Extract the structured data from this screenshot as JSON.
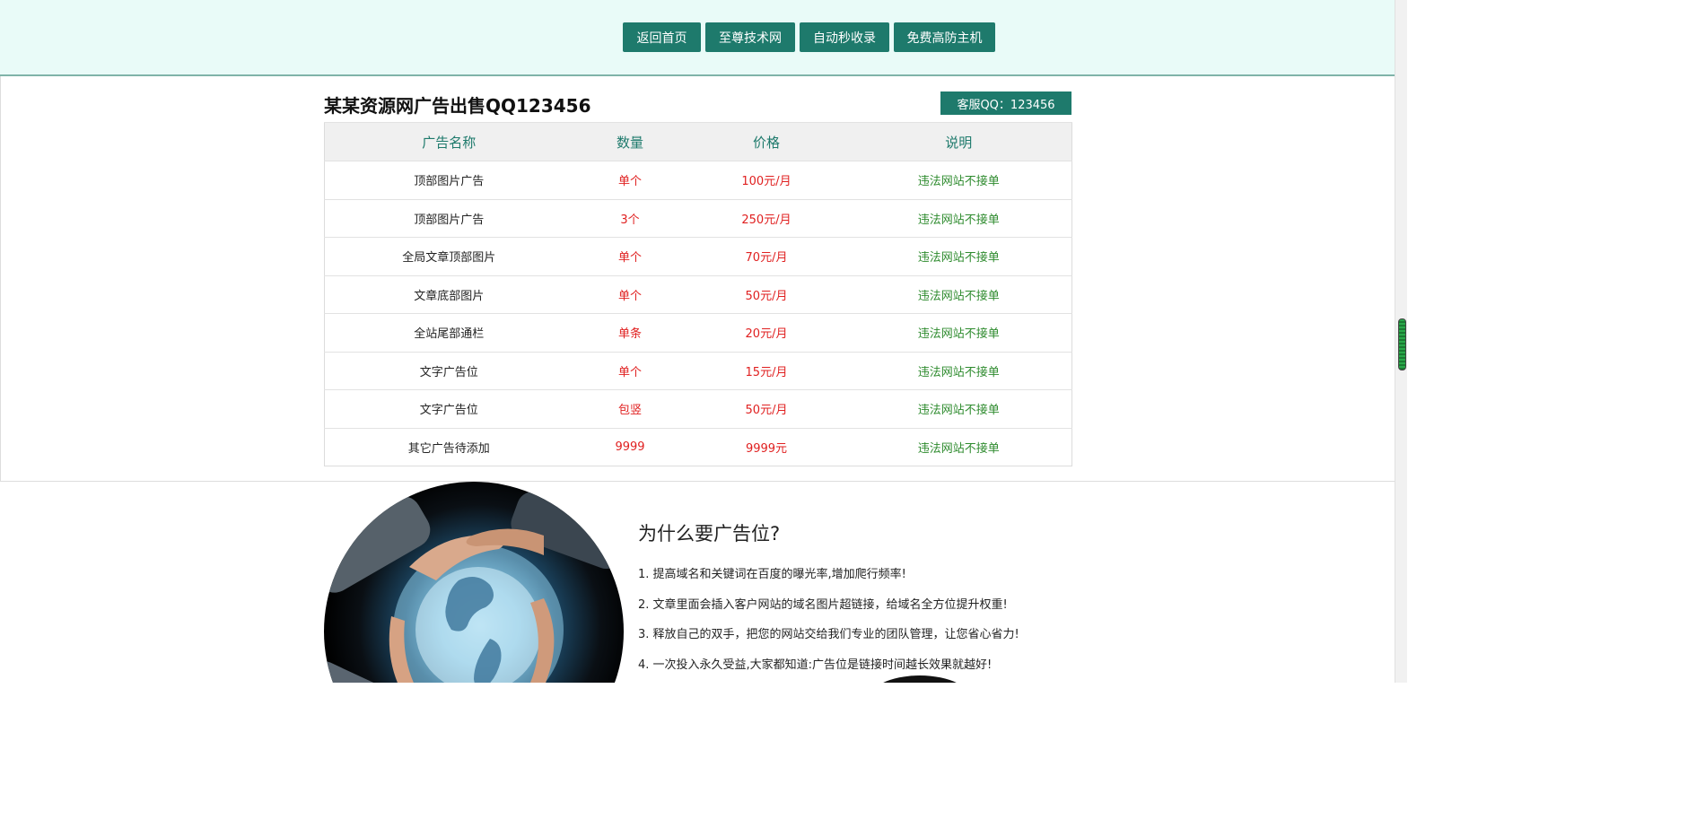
{
  "nav": {
    "items": [
      {
        "label": "返回首页"
      },
      {
        "label": "至尊技术网"
      },
      {
        "label": "自动秒收录"
      },
      {
        "label": "免费高防主机"
      }
    ]
  },
  "header": {
    "title": "某某资源网广告出售QQ123456",
    "qq_button": "客服QQ：123456"
  },
  "table": {
    "columns": [
      "广告名称",
      "数量",
      "价格",
      "说明"
    ],
    "rows": [
      {
        "name": "顶部图片广告",
        "qty": "单个",
        "price": "100元/月",
        "note": "违法网站不接单"
      },
      {
        "name": "顶部图片广告",
        "qty": "3个",
        "price": "250元/月",
        "note": "违法网站不接单"
      },
      {
        "name": "全局文章顶部图片",
        "qty": "单个",
        "price": "70元/月",
        "note": "违法网站不接单"
      },
      {
        "name": "文章底部图片",
        "qty": "单个",
        "price": "50元/月",
        "note": "违法网站不接单"
      },
      {
        "name": "全站尾部通栏",
        "qty": "单条",
        "price": "20元/月",
        "note": "违法网站不接单"
      },
      {
        "name": "文字广告位",
        "qty": "单个",
        "price": "15元/月",
        "note": "违法网站不接单"
      },
      {
        "name": "文字广告位",
        "qty": "包竖",
        "price": "50元/月",
        "note": "违法网站不接单"
      },
      {
        "name": "其它广告待添加",
        "qty": "9999",
        "price": "9999元",
        "note": "违法网站不接单"
      }
    ]
  },
  "why": {
    "title": "为什么要广告位?",
    "items": [
      "1. 提高域名和关键词在百度的曝光率,增加爬行频率!",
      "2. 文章里面会插入客户网站的域名图片超链接，给域名全方位提升权重!",
      "3. 释放自己的双手，把您的网站交给我们专业的团队管理，让您省心省力!",
      "4. 一次投入永久受益,大家都知道:广告位是链接时间越长效果就越好!"
    ]
  },
  "colors": {
    "accent": "#1e7a6c",
    "topbar_bg": "#e9fbf8",
    "red": "#e02020",
    "green": "#2e8b2e"
  }
}
